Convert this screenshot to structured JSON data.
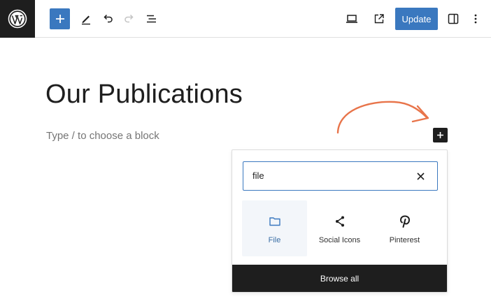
{
  "toolbar": {
    "logo_icon": "wordpress-icon",
    "add_icon": "plus-icon",
    "tools_icon": "pencil-icon",
    "undo_icon": "undo-icon",
    "redo_icon": "redo-icon",
    "list_view_icon": "list-view-icon",
    "preview_icon": "laptop-icon",
    "view_post_icon": "external-link-icon",
    "update_label": "Update",
    "settings_icon": "sidebar-toggle-icon",
    "options_icon": "more-vertical-icon"
  },
  "editor": {
    "title": "Our Publications",
    "placeholder": "Type / to choose a block"
  },
  "inserter": {
    "search_value": "file",
    "results": [
      {
        "label": "File",
        "icon": "folder-icon",
        "selected": true
      },
      {
        "label": "Social Icons",
        "icon": "share-icon",
        "selected": false
      },
      {
        "label": "Pinterest",
        "icon": "pinterest-icon",
        "selected": false
      }
    ],
    "browse_all_label": "Browse all"
  },
  "colors": {
    "accent": "#3a78bf",
    "dark": "#1e1e1e",
    "annotation_arrow": "#e8744a"
  }
}
